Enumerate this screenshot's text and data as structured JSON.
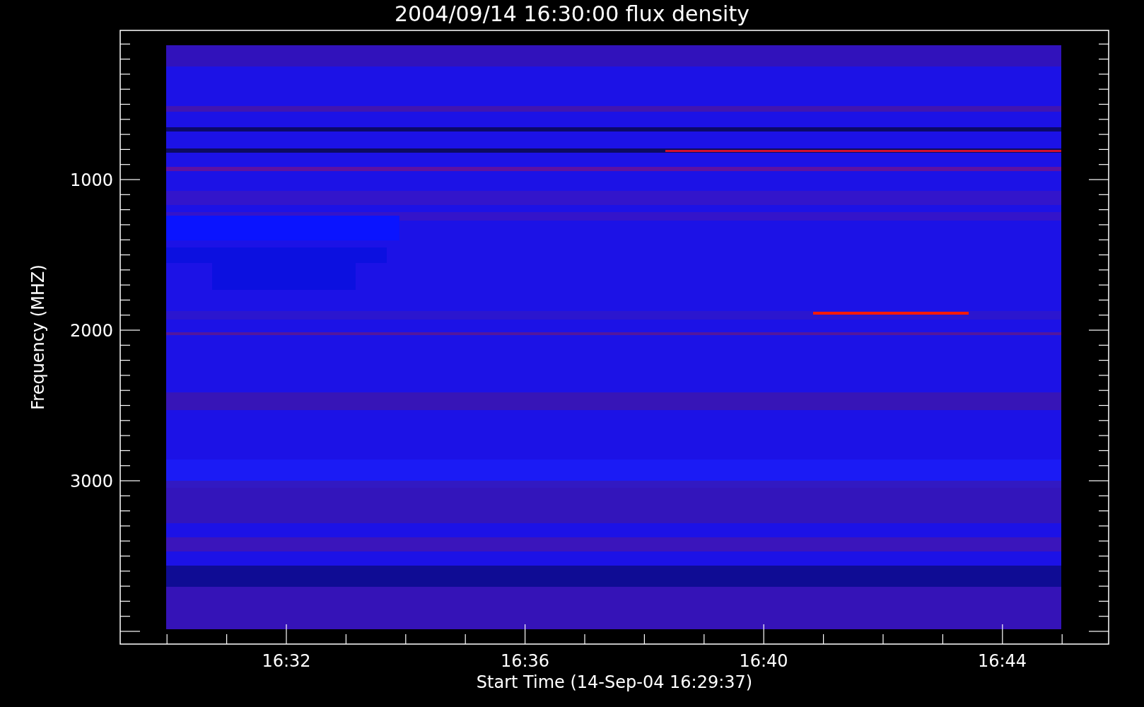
{
  "title": "2004/09/14 16:30:00 flux density",
  "plot": {
    "ylabel": "Frequency (MHZ)",
    "xlabel": "Start Time (14-Sep-04 16:29:37)",
    "yticks": [
      "1000",
      "2000",
      "3000"
    ],
    "xticks": [
      "16:32",
      "16:36",
      "16:40",
      "16:44"
    ]
  }
}
